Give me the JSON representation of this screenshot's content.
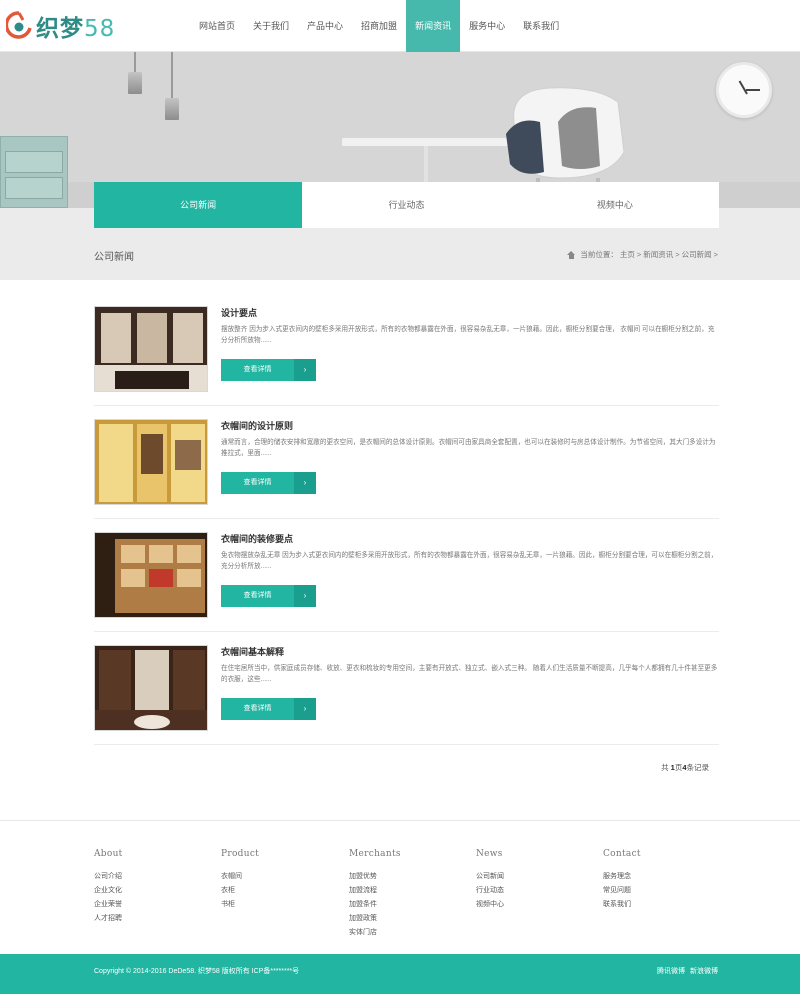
{
  "header": {
    "logo_text": "织梦",
    "logo_num": "58",
    "nav": [
      {
        "label": "网站首页",
        "active": false
      },
      {
        "label": "关于我们",
        "active": false
      },
      {
        "label": "产品中心",
        "active": false
      },
      {
        "label": "招商加盟",
        "active": false
      },
      {
        "label": "新闻资讯",
        "active": true
      },
      {
        "label": "服务中心",
        "active": false
      },
      {
        "label": "联系我们",
        "active": false
      }
    ]
  },
  "tabs": [
    {
      "label": "公司新闻",
      "active": true
    },
    {
      "label": "行业动态",
      "active": false
    },
    {
      "label": "视频中心",
      "active": false
    }
  ],
  "section": {
    "title": "公司新闻",
    "breadcrumb": {
      "prefix": "当前位置：",
      "items": [
        "主页",
        "新闻资讯",
        "公司新闻"
      ],
      "separator": ">"
    }
  },
  "articles": [
    {
      "title": "设计要点",
      "desc": "摆放整齐 因为步入式更衣间内的壁柜多采用开放形式，所有的衣物都暴露在外面，很容易杂乱无章，一片狼藉。因此，橱柜分割要合理， 衣帽间 可以在橱柜分割之前，充分分析所放物......",
      "button": "查看详情"
    },
    {
      "title": "衣帽间的设计原则",
      "desc": "通常而言，合理的储衣安排和宽敞的更衣空间，是衣帽间的总体设计原则。衣帽间可由家具商全套配置，也可以在装修时与房总体设计制作。为节省空间，其大门多设计为推拉式，里面......",
      "button": "查看详情"
    },
    {
      "title": "衣帽间的装修要点",
      "desc": "免衣物摆放杂乱无章 因为步入式更衣间内的壁柜多采用开放形式，所有的衣物都暴露在外面，很容易杂乱无章，一片狼藉。因此，橱柜分割要合理，可以在橱柜分割之前，充分分析所放......",
      "button": "查看详情"
    },
    {
      "title": "衣帽间基本解释",
      "desc": "在住宅居所当中，供家庭成员存储、收放、更衣和梳妆的专用空间，主要有开放式、独立式、嵌入式三种。 随着人们生活质量不断提高，几乎每个人都拥有几十件甚至更多的衣服，这些......",
      "button": "查看详情"
    }
  ],
  "pagination": {
    "prefix": "共 ",
    "pages": "1",
    "mid": "页",
    "count": "4",
    "suffix": "条记录"
  },
  "footer": {
    "columns": [
      {
        "heading": "About",
        "links": [
          "公司介绍",
          "企业文化",
          "企业荣誉",
          "人才招聘"
        ]
      },
      {
        "heading": "Product",
        "links": [
          "衣帽间",
          "衣柜",
          "书柜"
        ]
      },
      {
        "heading": "Merchants",
        "links": [
          "加盟优势",
          "加盟流程",
          "加盟条件",
          "加盟政策",
          "实体门店"
        ]
      },
      {
        "heading": "News",
        "links": [
          "公司新闻",
          "行业动态",
          "视频中心"
        ]
      },
      {
        "heading": "Contact",
        "links": [
          "服务理念",
          "常见问题",
          "联系我们"
        ]
      }
    ],
    "copyright": "Copyright © 2014-2016 DeDe58. 织梦58 版权所有  ICP备********号",
    "socials": [
      "腾讯微博",
      "新浪微博"
    ]
  },
  "colors": {
    "accent": "#22b5a2",
    "accent_dark": "#1a9e8d",
    "nav_active": "#46b9ac"
  }
}
